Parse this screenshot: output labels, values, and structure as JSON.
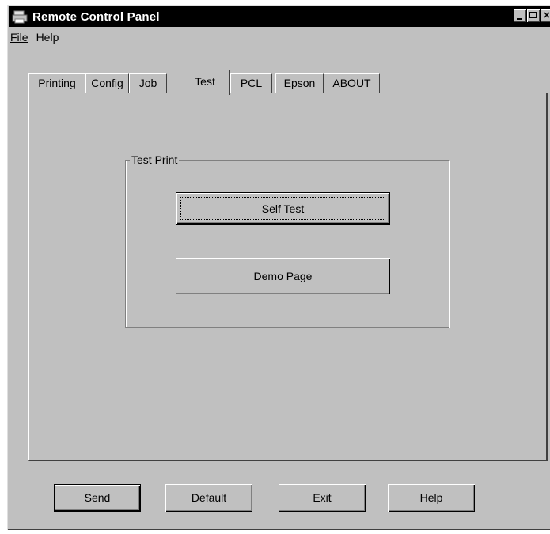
{
  "window": {
    "title": "Remote Control Panel",
    "icon": "printer-icon",
    "controls": [
      "minimize-icon",
      "maximize-icon",
      "close-icon"
    ]
  },
  "menu": {
    "items": [
      {
        "label": "File"
      },
      {
        "label": "Help"
      }
    ]
  },
  "tabs": [
    {
      "label": "Printing",
      "active": false
    },
    {
      "label": "Config",
      "active": false
    },
    {
      "label": "Job",
      "active": false
    },
    {
      "label": "Test",
      "active": true
    },
    {
      "label": "PCL",
      "active": false
    },
    {
      "label": "Epson",
      "active": false
    },
    {
      "label": "ABOUT",
      "active": false
    }
  ],
  "test_print": {
    "group_title": "Test Print",
    "self_test_label": "Self Test",
    "demo_page_label": "Demo Page"
  },
  "footer": {
    "send_label": "Send",
    "default_label": "Default",
    "exit_label": "Exit",
    "help_label": "Help"
  },
  "colors": {
    "face": "#c0c0c0",
    "titlebar": "#000000",
    "highlight": "#ffffff",
    "shadow": "#404040"
  }
}
